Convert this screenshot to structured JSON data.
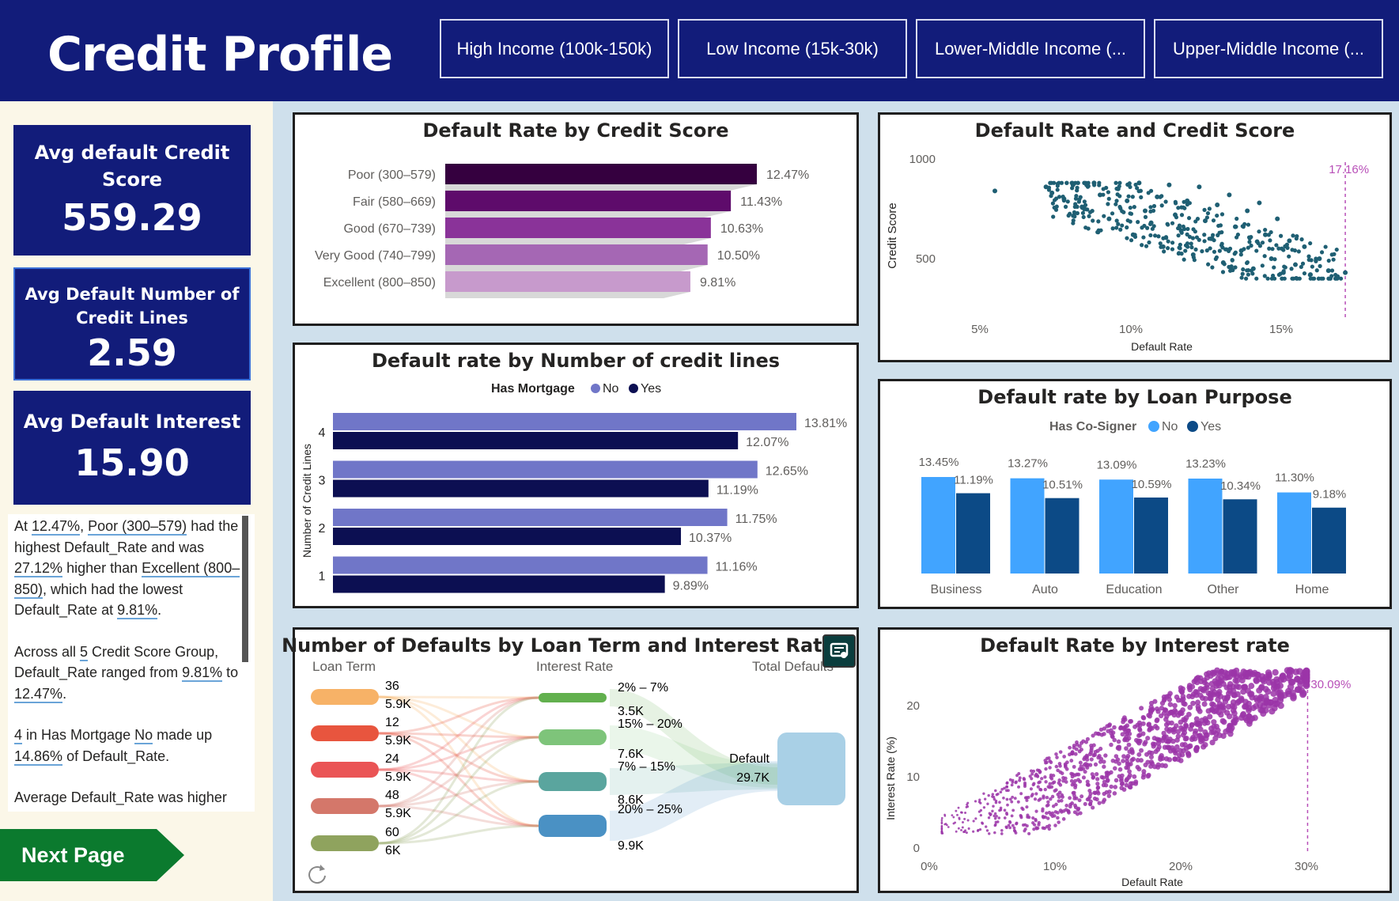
{
  "header": {
    "title": "Credit Profile",
    "slicers": [
      "High Income (100k-150k)",
      "Low Income (15k-30k)",
      "Lower-Middle Income (...",
      "Upper-Middle Income (..."
    ]
  },
  "kpis": {
    "credit_score": {
      "label": "Avg default Credit Score",
      "value": "559.29"
    },
    "credit_lines": {
      "label": "Avg Default Number of Credit Lines",
      "value": "2.59"
    },
    "interest": {
      "label": "Avg Default Interest",
      "value": "15.90"
    }
  },
  "narrative": {
    "p1": {
      "t1": "At ",
      "v1": "12.47%",
      "t2": ", ",
      "v2": "Poor (300–579)",
      "t3": " had the highest Default_Rate and was ",
      "v3": "27.12%",
      "t4": " higher than ",
      "v4": "Excellent (800–850)",
      "t5": ", which had the lowest Default_Rate at ",
      "v5": "9.81%",
      "t6": "."
    },
    "p2": {
      "t1": "Across all ",
      "v1": "5",
      "t2": " Credit Score Group, Default_Rate ranged from ",
      "v2": "9.81%",
      "t3": " to ",
      "v3": "12.47%",
      "t4": "."
    },
    "p3": {
      "v1": "4",
      "t1": " in Has Mortgage ",
      "v2": "No",
      "t2": " made up ",
      "v3": "14.86%",
      "t3": " of Default_Rate."
    },
    "p4": {
      "t1": "Average Default_Rate was higher"
    }
  },
  "nav": {
    "next_label": "Next Page"
  },
  "colors": {
    "header": "#121c7a",
    "panel": "#fbf7e8",
    "background": "#cfe0ec",
    "next_button": "#0b7a2e",
    "scatter_teal": "#1f5f73",
    "scatter_purple": "#9b35a8"
  },
  "chart_data": [
    {
      "id": "default_by_score",
      "type": "bar",
      "orientation": "horizontal",
      "title": "Default Rate by Credit Score",
      "categories": [
        "Poor (300–579)",
        "Fair (580–669)",
        "Good (670–739)",
        "Very Good (740–799)",
        "Excellent (800–850)"
      ],
      "values": [
        12.47,
        11.43,
        10.63,
        10.5,
        9.81
      ],
      "labels": [
        "12.47%",
        "11.43%",
        "10.63%",
        "10.50%",
        "9.81%"
      ],
      "colors": [
        "#35003f",
        "#5e0b6b",
        "#8a3399",
        "#a567b4",
        "#c79acc"
      ]
    },
    {
      "id": "default_by_lines",
      "type": "bar",
      "orientation": "horizontal",
      "title": "Default rate by Number of credit lines",
      "ylabel": "Number of Credit Lines",
      "legend_title": "Has Mortgage",
      "legend_position": "top",
      "categories": [
        "4",
        "3",
        "2",
        "1"
      ],
      "series": [
        {
          "name": "No",
          "color": "#7076c8",
          "values": [
            13.81,
            12.65,
            11.75,
            11.16
          ],
          "labels": [
            "13.81%",
            "12.65%",
            "11.75%",
            "11.16%"
          ]
        },
        {
          "name": "Yes",
          "color": "#0c0f52",
          "values": [
            12.07,
            11.19,
            10.37,
            9.89
          ],
          "labels": [
            "12.07%",
            "11.19%",
            "10.37%",
            "9.89%"
          ]
        }
      ]
    },
    {
      "id": "default_score_scatter",
      "type": "scatter",
      "title": "Default Rate and Credit Score",
      "xlabel": "Default Rate",
      "ylabel": "Credit Score",
      "xticks": [
        "5%",
        "10%",
        "15%"
      ],
      "yticks": [
        "500",
        "1000"
      ],
      "xlim": [
        5,
        17.5
      ],
      "ylim": [
        0,
        1000
      ],
      "reference_line": {
        "x": 17.16,
        "label": "17.16%"
      },
      "points": [
        [
          5.5,
          840
        ],
        [
          7.2,
          860
        ],
        [
          7.4,
          830
        ],
        [
          7.8,
          800
        ],
        [
          8.1,
          870
        ],
        [
          8.4,
          760
        ],
        [
          8.8,
          880
        ],
        [
          9.0,
          820
        ],
        [
          9.3,
          700
        ],
        [
          9.6,
          850
        ],
        [
          9.9,
          790
        ],
        [
          10.1,
          620
        ],
        [
          10.3,
          880
        ],
        [
          10.5,
          740
        ],
        [
          10.7,
          680
        ],
        [
          10.9,
          810
        ],
        [
          11.1,
          560
        ],
        [
          11.3,
          870
        ],
        [
          11.5,
          720
        ],
        [
          11.7,
          640
        ],
        [
          11.9,
          790
        ],
        [
          12.1,
          520
        ],
        [
          12.3,
          860
        ],
        [
          12.5,
          690
        ],
        [
          12.7,
          600
        ],
        [
          12.9,
          770
        ],
        [
          13.1,
          480
        ],
        [
          13.3,
          820
        ],
        [
          13.5,
          660
        ],
        [
          13.7,
          540
        ],
        [
          13.9,
          740
        ],
        [
          14.1,
          450
        ],
        [
          14.3,
          780
        ],
        [
          14.5,
          620
        ],
        [
          14.7,
          500
        ],
        [
          14.9,
          700
        ],
        [
          15.1,
          430
        ],
        [
          15.3,
          590
        ],
        [
          15.5,
          470
        ],
        [
          15.8,
          560
        ],
        [
          16.0,
          420
        ],
        [
          16.3,
          500
        ],
        [
          16.6,
          440
        ],
        [
          16.9,
          410
        ],
        [
          17.16,
          430
        ]
      ]
    },
    {
      "id": "default_by_purpose",
      "type": "bar",
      "title": "Default rate by Loan Purpose",
      "legend_title": "Has Co-Signer",
      "legend_position": "top",
      "categories": [
        "Business",
        "Auto",
        "Education",
        "Other",
        "Home"
      ],
      "series": [
        {
          "name": "No",
          "color": "#41a4ff",
          "values": [
            13.45,
            13.27,
            13.09,
            13.23,
            11.3
          ],
          "labels": [
            "13.45%",
            "13.27%",
            "13.09%",
            "13.23%",
            "11.30%"
          ]
        },
        {
          "name": "Yes",
          "color": "#0c4a86",
          "values": [
            11.19,
            10.51,
            10.59,
            10.34,
            9.18
          ],
          "labels": [
            "11.19%",
            "10.51%",
            "10.59%",
            "10.34%",
            "9.18%"
          ]
        }
      ]
    },
    {
      "id": "sankey",
      "type": "sankey",
      "title": "Number of Defaults by Loan Term and Interest Rate",
      "column_headers": [
        "Loan Term",
        "Interest Rate",
        "Total Defaults"
      ],
      "sources": [
        {
          "name": "36",
          "value": "5.9K",
          "color": "#f7b267"
        },
        {
          "name": "12",
          "value": "5.9K",
          "color": "#e8553e"
        },
        {
          "name": "24",
          "value": "5.9K",
          "color": "#ea5455"
        },
        {
          "name": "48",
          "value": "5.9K",
          "color": "#d4776a"
        },
        {
          "name": "60",
          "value": "6K",
          "color": "#8fa35e"
        }
      ],
      "middle": [
        {
          "name": "2% – 7%",
          "value": "3.5K",
          "color": "#62b04e"
        },
        {
          "name": "15% – 20%",
          "value": "7.6K",
          "color": "#7ec47a"
        },
        {
          "name": "7% – 15%",
          "value": "8.6K",
          "color": "#5aa59e"
        },
        {
          "name": "20% – 25%",
          "value": "9.9K",
          "color": "#4a91c4"
        }
      ],
      "target": {
        "name": "Default",
        "value": "29.7K",
        "color": "#a9d0e6"
      }
    },
    {
      "id": "interest_scatter",
      "type": "scatter",
      "title": "Default Rate by Interest rate",
      "xlabel": "Default Rate",
      "ylabel": "Interest Rate (%)",
      "xticks": [
        "0%",
        "10%",
        "20%",
        "30%"
      ],
      "yticks": [
        "0",
        "10",
        "20"
      ],
      "xlim": [
        0,
        33
      ],
      "ylim": [
        0,
        26
      ],
      "reference_line": {
        "x": 30.09,
        "label": "30.09%"
      },
      "trend": "positive correlation; dense band rising from (1,2) to (27,24)"
    }
  ]
}
